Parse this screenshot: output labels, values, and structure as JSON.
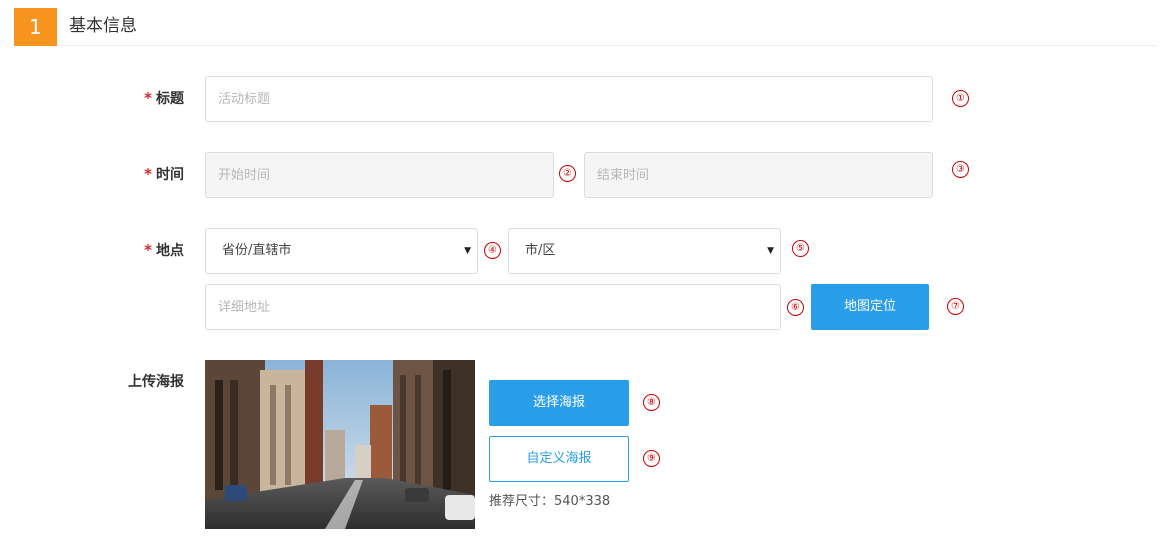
{
  "section": {
    "number": "1",
    "title": "基本信息"
  },
  "form": {
    "required_mark": "*",
    "title_label": "标题",
    "title_placeholder": "活动标题",
    "time_label": "时间",
    "start_placeholder": "开始时间",
    "end_placeholder": "结束时间",
    "location_label": "地点",
    "province_value": "省份/直辖市",
    "city_value": "市/区",
    "address_placeholder": "详细地址",
    "map_button": "地图定位",
    "poster_label": "上传海报",
    "choose_poster_button": "选择海报",
    "custom_poster_button": "自定义海报",
    "poster_hint": "推荐尺寸：540*338"
  },
  "markers": [
    "①",
    "②",
    "③",
    "④",
    "⑤",
    "⑥",
    "⑦",
    "⑧",
    "⑨"
  ],
  "colors": {
    "accent": "#f7941d",
    "primary": "#2a9ee8",
    "required": "#d9262c",
    "marker": "#cc0000"
  },
  "icons": {
    "select_caret": "▼"
  }
}
